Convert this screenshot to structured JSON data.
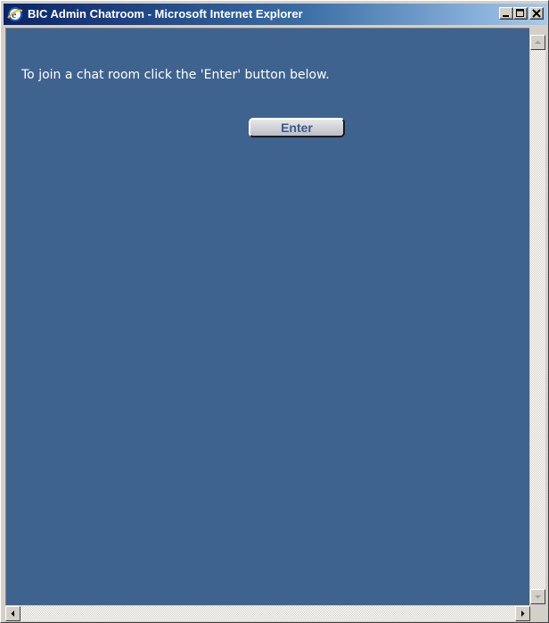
{
  "window": {
    "title": "BIC Admin Chatroom - Microsoft Internet Explorer"
  },
  "page": {
    "message": "To join a chat room click the 'Enter' button below.",
    "enter_label": "Enter",
    "background_color": "#3e638f",
    "text_color": "#ffffff"
  },
  "icons": {
    "app": "ie-icon",
    "minimize": "minimize-icon",
    "maximize": "maximize-icon",
    "close": "close-icon",
    "scroll_up": "arrow-up-icon",
    "scroll_down": "arrow-down-icon",
    "scroll_left": "arrow-left-icon",
    "scroll_right": "arrow-right-icon"
  }
}
